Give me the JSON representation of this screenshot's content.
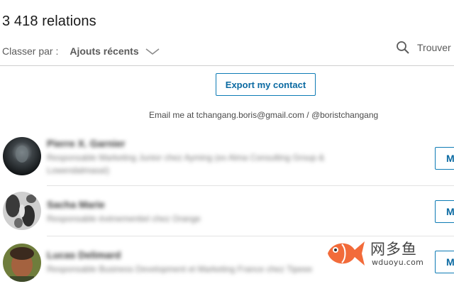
{
  "header": {
    "connection_count": "3 418 relations"
  },
  "sort": {
    "label": "Classer par :",
    "selected": "Ajouts récents",
    "chevron_icon": "chevron-down-icon"
  },
  "search": {
    "icon": "search-icon",
    "placeholder": "Trouver des relations"
  },
  "promo": {
    "export_button": "Export my contact",
    "contact_line": "Email me at tchangang.boris@gmail.com / @boristchangang"
  },
  "connections": [
    {
      "name": "Pierre X. Garnier",
      "headline": "Responsable Marketing Junior chez Ayming (ex Alma Consulting Group & Lowendalmasaï)",
      "action": "M"
    },
    {
      "name": "Sacha Marie",
      "headline": "Responsable événementiel chez Orange",
      "action": "M"
    },
    {
      "name": "Lucas Delimard",
      "headline": "Responsable Business Development et Marketing France chez Tipeee",
      "action": "M"
    }
  ],
  "watermark": {
    "brand_cn": "网多鱼",
    "url": "wduoyu.com"
  },
  "colors": {
    "accent": "#0b6aa2",
    "watermark_fish": "#f26b3a"
  }
}
